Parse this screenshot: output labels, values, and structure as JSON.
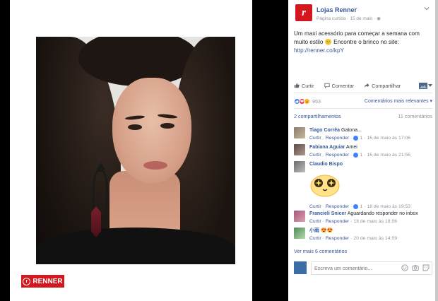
{
  "page": {
    "name": "Lojas Renner",
    "meta": "Página curtida · 15 de maio ·",
    "avatar_letter": "r"
  },
  "post": {
    "text_before_link": "Um maxi acessório para começar a semana com muito estilo 🙂 Encontre o brinco no site: ",
    "link": "http://renner.co/kpY"
  },
  "badge": {
    "label": "RENNER"
  },
  "actions": {
    "like": "Curtir",
    "comment": "Comentar",
    "share": "Compartilhar"
  },
  "reactions": {
    "count": "953",
    "sort_label": "Comentários mais relevantes ▾"
  },
  "counts": {
    "shares": "2 compartilhamentos",
    "comments": "11 comentários"
  },
  "comments": [
    {
      "name": "Tiago Corrêa",
      "text": "Gatona...",
      "like": "Curtir",
      "reply": "Responder",
      "likes": "1",
      "time": "15 de maio às 17:06"
    },
    {
      "name": "Fabiana Aguiar",
      "text": "Amei",
      "like": "Curtir",
      "reply": "Responder",
      "likes": "1",
      "time": "15 de maio às 21:55"
    },
    {
      "name": "Claudio Bispo",
      "text": "",
      "like": "Curtir",
      "reply": "Responder",
      "likes": "1",
      "time": "18 de maio às 19:53"
    },
    {
      "name": "Francieli Snicer",
      "text": "Aguardando responder no inbox",
      "like": "Curtir",
      "reply": "Responder",
      "likes": "",
      "time": "18 de maio às 18:06"
    },
    {
      "name": "小雨",
      "text": "😍😍",
      "like": "Curtir",
      "reply": "Responder",
      "likes": "",
      "time": "20 de maio às 14:09"
    }
  ],
  "see_more": "Ver mais 6 comentários",
  "composer": {
    "placeholder": "Escreva um comentário..."
  },
  "colors": {
    "brand": "#d4161f",
    "link": "#365899",
    "muted": "#90949c"
  }
}
